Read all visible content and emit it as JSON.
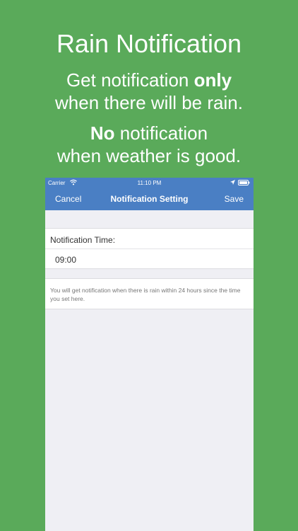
{
  "promo": {
    "title": "Rain Notification",
    "line1_pre": "Get notification ",
    "line1_bold": "only",
    "line2": "when there will be rain.",
    "line3_bold": "No",
    "line3_post": " notification",
    "line4": "when weather is good."
  },
  "status_bar": {
    "carrier": "Carrier",
    "time": "11:10 PM",
    "wifi_icon": "wifi-icon",
    "location_icon": "location-arrow-icon",
    "battery_icon": "battery-icon"
  },
  "navbar": {
    "cancel_label": "Cancel",
    "title": "Notification Setting",
    "save_label": "Save"
  },
  "settings": {
    "time_label": "Notification Time:",
    "time_value": "09:00",
    "info_text": "You will get notification when there is rain within 24 hours since the time you set here."
  },
  "colors": {
    "background": "#5aaa5a",
    "navbar": "#4a7fc4",
    "screen_bg": "#efeff4"
  }
}
